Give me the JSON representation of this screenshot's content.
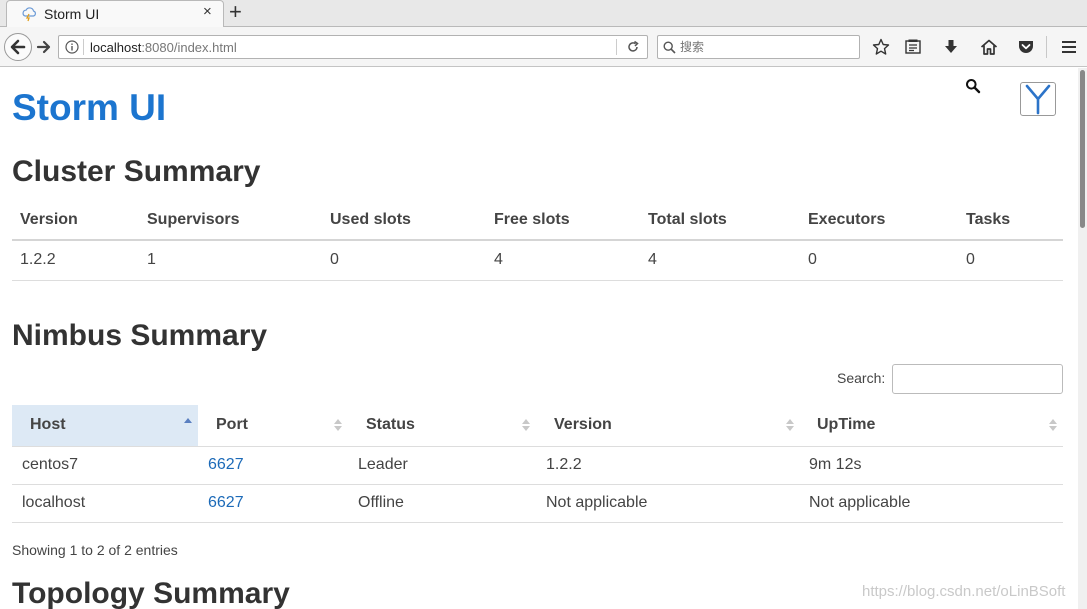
{
  "browser": {
    "tab_title": "Storm UI",
    "tab_close": "×",
    "new_tab": "+",
    "url_host": "localhost",
    "url_rest": ":8080/index.html",
    "search_placeholder": "搜索"
  },
  "page": {
    "brand": "Storm UI",
    "cluster_title": "Cluster Summary",
    "nimbus_title": "Nimbus Summary",
    "topology_title": "Topology Summary",
    "search_label": "Search:",
    "showing": "Showing 1 to 2 of 2 entries",
    "watermark": "https://blog.csdn.net/oLinBSoft"
  },
  "cluster": {
    "headers": [
      "Version",
      "Supervisors",
      "Used slots",
      "Free slots",
      "Total slots",
      "Executors",
      "Tasks"
    ],
    "row": [
      "1.2.2",
      "1",
      "0",
      "4",
      "4",
      "0",
      "0"
    ]
  },
  "nimbus": {
    "headers": [
      "Host",
      "Port",
      "Status",
      "Version",
      "UpTime"
    ],
    "rows": [
      [
        "centos7",
        "6627",
        "Leader",
        "1.2.2",
        "9m 12s"
      ],
      [
        "localhost",
        "6627",
        "Offline",
        "Not applicable",
        "Not applicable"
      ]
    ]
  },
  "colors": {
    "brand": "#1c75cf",
    "link": "#1c6ab8",
    "sorted_header_bg": "#dde9f5"
  }
}
